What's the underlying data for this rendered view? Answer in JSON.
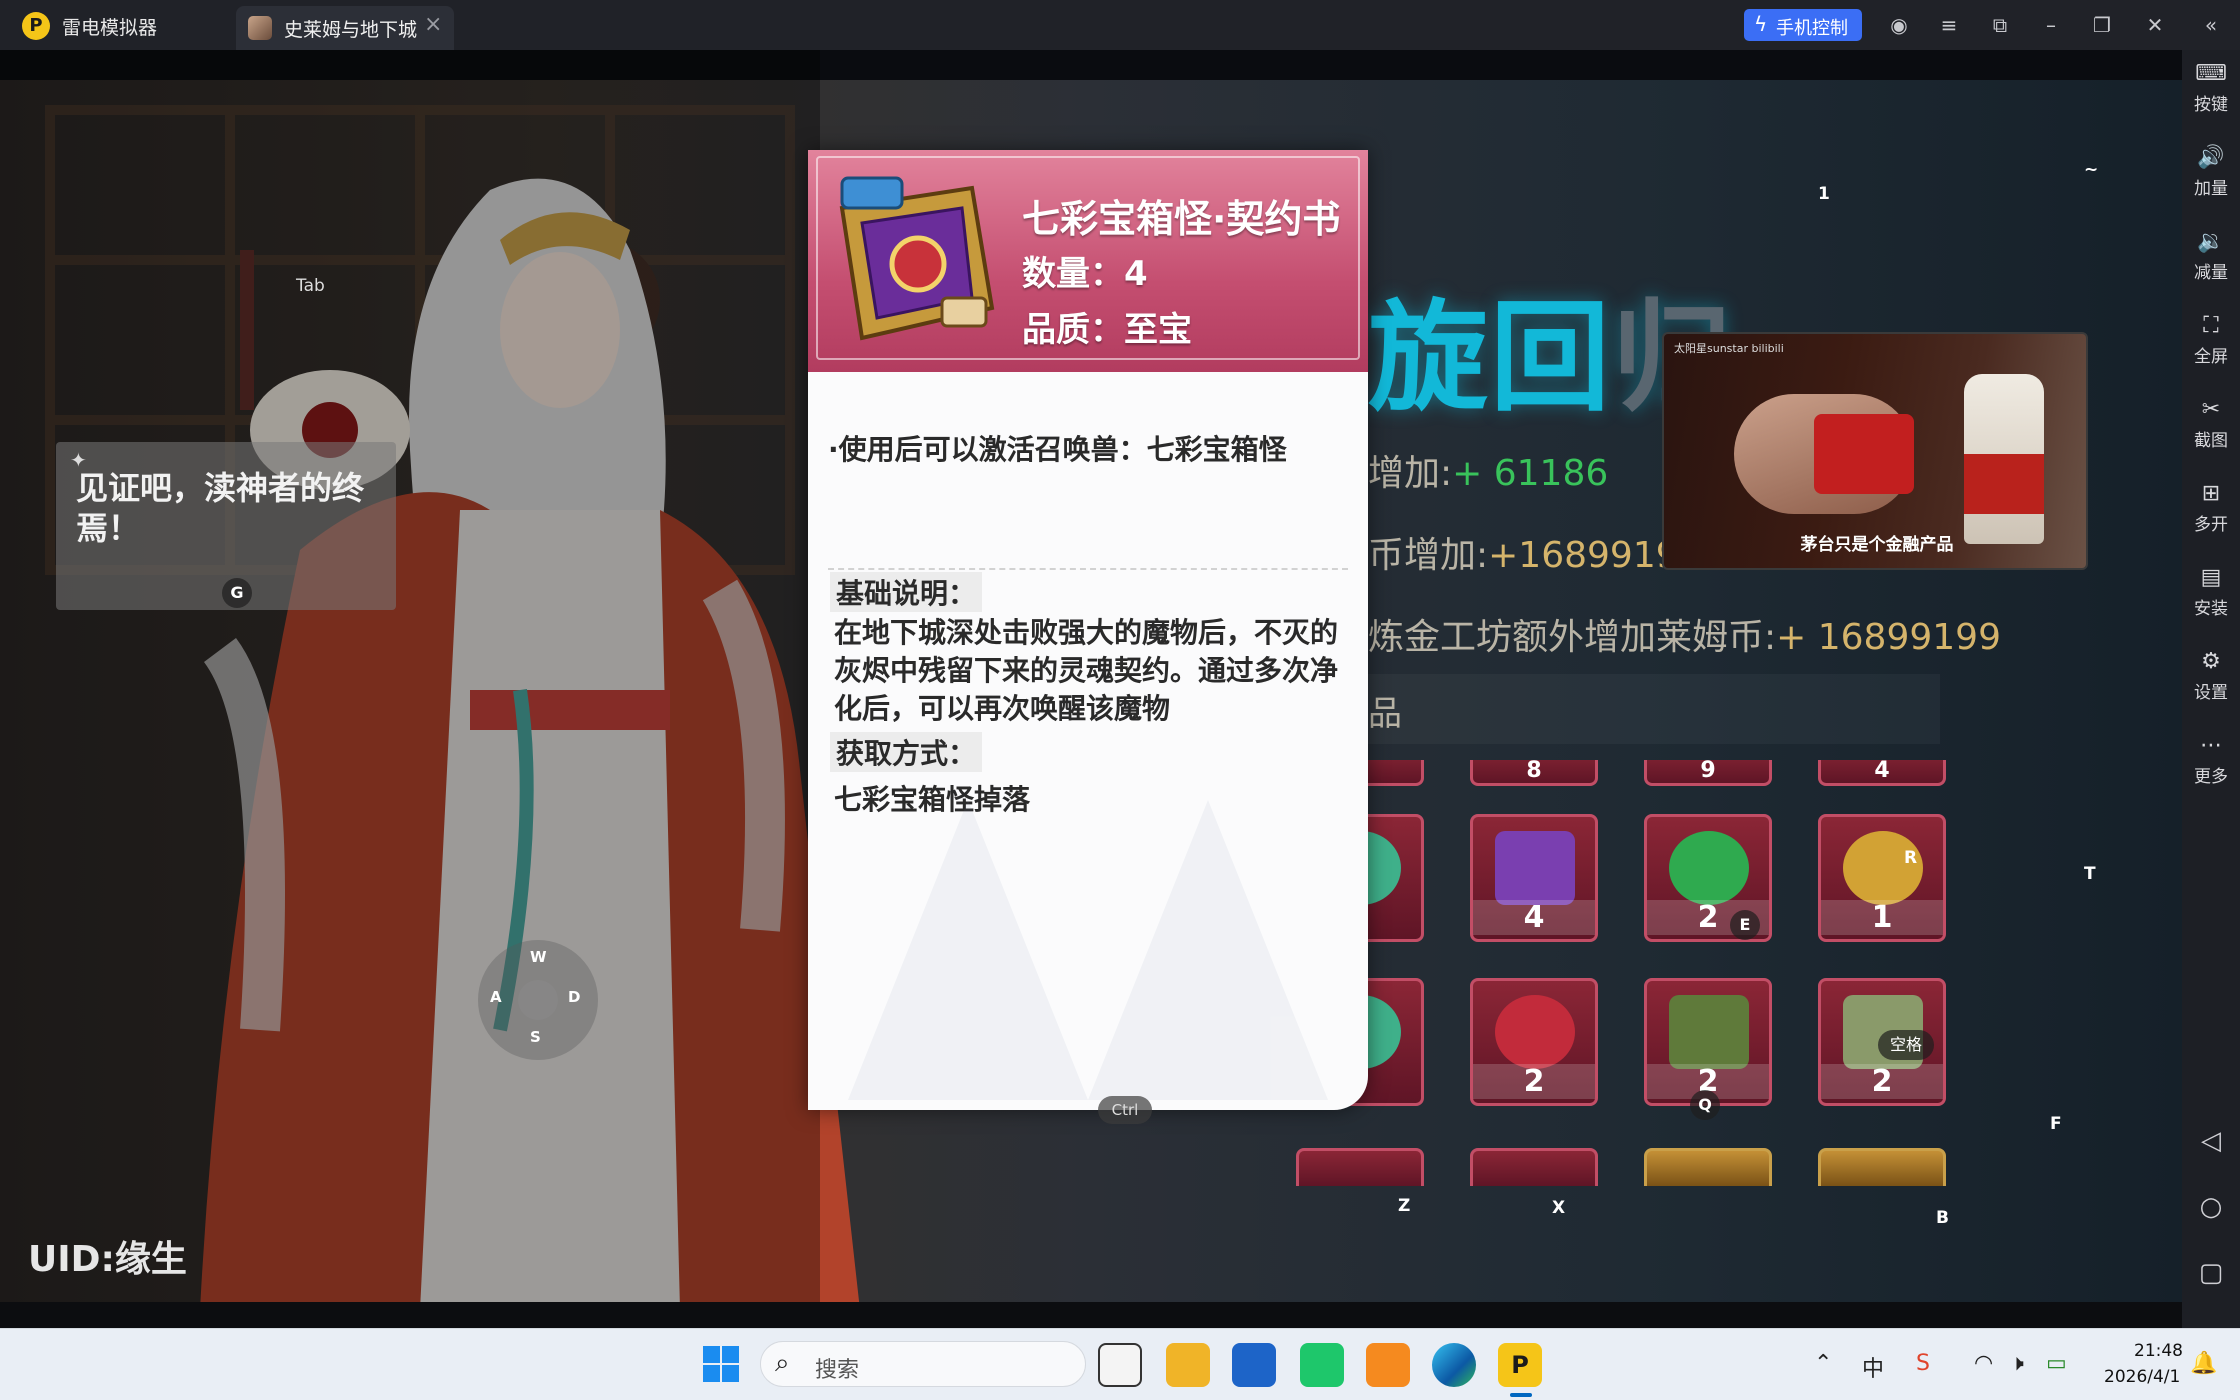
{
  "titlebar": {
    "app_name": "雷电模拟器",
    "tab_label": "史莱姆与地下城",
    "phone_control": "手机控制"
  },
  "game": {
    "speech": "见证吧，渎神者的终焉！",
    "uid": "UID:缘生",
    "reward_title": "旋回",
    "reward_title_dim": "归",
    "reward_lines": [
      {
        "label": "增加:",
        "value": "+ 61186"
      },
      {
        "label": "币增加:",
        "value": "+16899199"
      },
      {
        "label": "炼金工坊额外增加莱姆币:",
        "value": "+ 16899199"
      }
    ],
    "items_header": "品",
    "top_row_counts": [
      "8",
      "9",
      "4"
    ],
    "slots_row1": [
      {
        "count": "",
        "color": "#3fb08a"
      },
      {
        "count": "4",
        "color": "#7a3fb0"
      },
      {
        "count": "2",
        "color": "#2faa4f"
      },
      {
        "count": "1",
        "color": "#d2a234"
      }
    ],
    "slots_row2": [
      {
        "count": "",
        "color": "#3fb08a"
      },
      {
        "count": "2",
        "color": "#c22b3b"
      },
      {
        "count": "2",
        "color": "#5f7a3a"
      },
      {
        "count": "2",
        "color": "#8a9a6a"
      }
    ],
    "video": {
      "brand": "太阳星sunstar bilibili",
      "caption": "茅台只是个金融产品"
    },
    "keys": {
      "tab": "Tab",
      "g": "G",
      "one": "1",
      "tilde": "~",
      "t": "T",
      "r": "R",
      "e": "E",
      "q": "Q",
      "space": "空格",
      "f": "F",
      "z": "Z",
      "x": "X",
      "b": "B",
      "w": "W",
      "a": "A",
      "s": "S",
      "d": "D",
      "ctrl": "Ctrl"
    }
  },
  "popup": {
    "title": "七彩宝箱怪·契约书",
    "quantity": "数量：4",
    "quality": "品质：至宝",
    "use_effect": "·使用后可以激活召唤兽：七彩宝箱怪",
    "basic_header": "基础说明：",
    "basic_desc": "在地下城深处击败强大的魔物后，不灭的灰烬中残留下来的灵魂契约。通过多次净化后，可以再次唤醒该魔物",
    "obtain_header": "获取方式：",
    "obtain_source": "七彩宝箱怪掉落"
  },
  "sidebar": {
    "items": [
      {
        "icon": "keyboard-icon",
        "label": "按键"
      },
      {
        "icon": "volume-up-icon",
        "label": "加量"
      },
      {
        "icon": "volume-down-icon",
        "label": "减量"
      },
      {
        "icon": "fullscreen-icon",
        "label": "全屏"
      },
      {
        "icon": "scissors-icon",
        "label": "截图"
      },
      {
        "icon": "multi-instance-icon",
        "label": "多开"
      },
      {
        "icon": "apk-install-icon",
        "label": "安装"
      },
      {
        "icon": "gear-icon",
        "label": "设置"
      },
      {
        "icon": "more-icon",
        "label": "更多"
      }
    ]
  },
  "taskbar": {
    "search_placeholder": "搜索",
    "ime": "中",
    "time": "21:48",
    "date": "2026/4/1"
  }
}
